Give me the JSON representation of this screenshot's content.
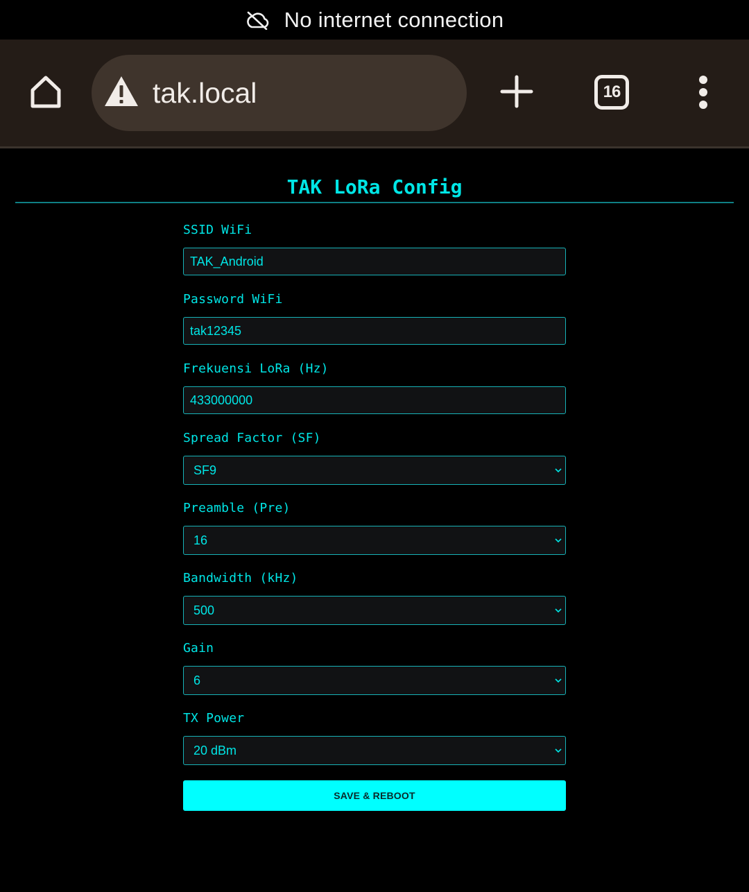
{
  "status_bar": {
    "icon": "cloud-off-icon",
    "text": "No internet connection"
  },
  "browser": {
    "url": "tak.local",
    "security_icon": "warning-icon",
    "tab_count": "16",
    "icons": [
      "home-icon",
      "plus-icon",
      "tabs-icon",
      "more-vertical-icon"
    ],
    "bar_color": "#241c17",
    "pill_color": "#3f342c"
  },
  "page": {
    "title": "TAK LoRa Config",
    "accent_color": "#00e6e6",
    "fields": {
      "ssid": {
        "label": "SSID WiFi",
        "value": "TAK_Android"
      },
      "password": {
        "label": "Password WiFi",
        "value": "tak12345"
      },
      "frequency": {
        "label": "Frekuensi LoRa (Hz)",
        "value": "433000000"
      },
      "spread_factor": {
        "label": "Spread Factor (SF)",
        "value": "SF9"
      },
      "preamble": {
        "label": "Preamble (Pre)",
        "value": "16"
      },
      "bandwidth": {
        "label": "Bandwidth (kHz)",
        "value": "500"
      },
      "gain": {
        "label": "Gain",
        "value": "6"
      },
      "tx_power": {
        "label": "TX Power",
        "value": "20 dBm"
      }
    },
    "save_button": {
      "label": "SAVE & REBOOT",
      "color": "#00ffff"
    }
  }
}
